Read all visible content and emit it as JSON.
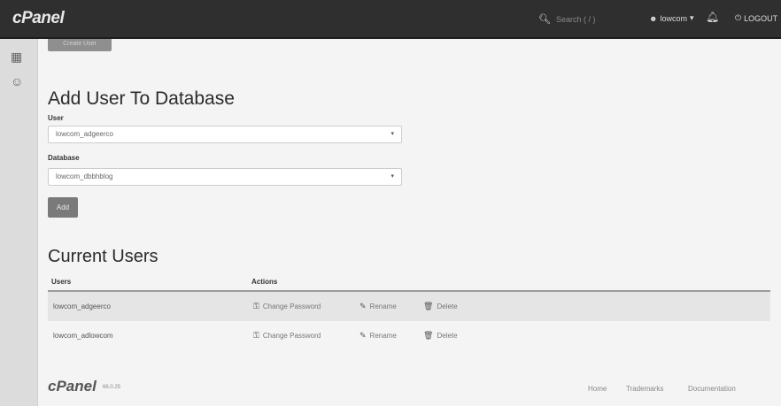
{
  "brand": "cPanel",
  "header": {
    "search_placeholder": "Search ( / )",
    "username": "lowcom",
    "logout_label": "LOGOUT"
  },
  "top_stub_button": "Create User",
  "add_user_to_db": {
    "title": "Add User To Database",
    "user_label": "User",
    "user_value": "lowcom_adgeerco",
    "database_label": "Database",
    "database_value": "lowcom_dbbhblog",
    "add_label": "Add"
  },
  "current_users": {
    "title": "Current Users",
    "col_users": "Users",
    "col_actions": "Actions",
    "rows": [
      {
        "user": "lowcom_adgeerco"
      },
      {
        "user": "lowcom_adlowcom"
      }
    ],
    "actions": {
      "change_password": "Change Password",
      "rename": "Rename",
      "delete": "Delete"
    }
  },
  "footer": {
    "brand": "cPanel",
    "version": "66.0.25",
    "links": [
      "Home",
      "Trademarks",
      "Documentation"
    ]
  }
}
